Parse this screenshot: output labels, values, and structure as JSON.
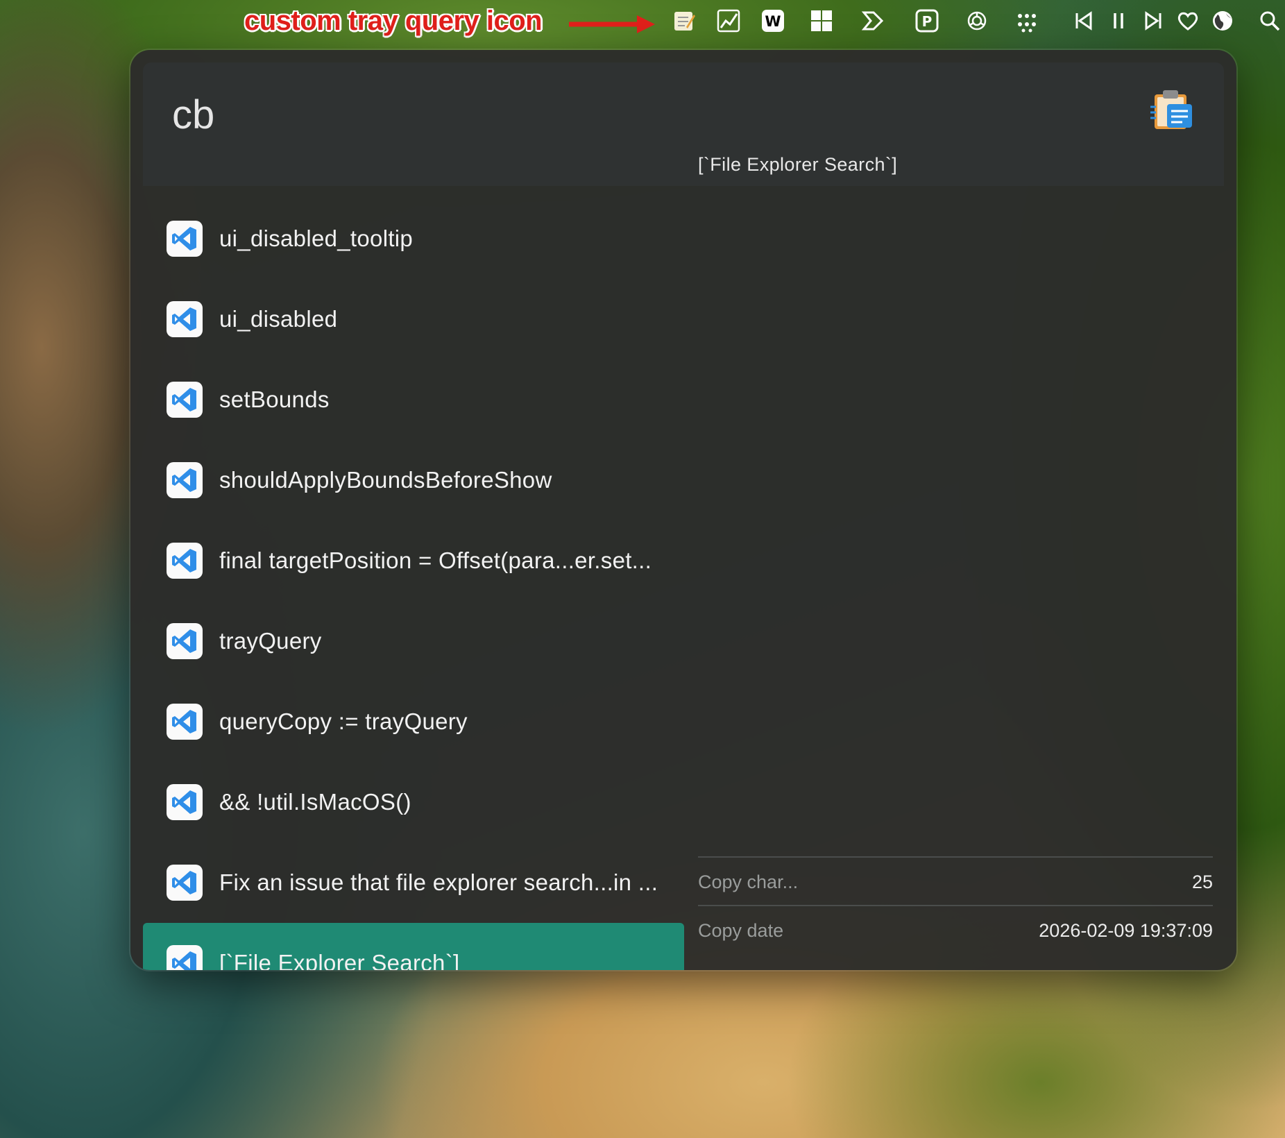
{
  "annotation": {
    "text": "custom tray query icon"
  },
  "menubar": {
    "icons": [
      "notepad-icon",
      "chart-icon",
      "word-icon",
      "grid-icon",
      "forward-arrow-icon",
      "p-app-icon",
      "openai-icon",
      "dots-icon",
      "previous-track-icon",
      "pause-icon",
      "next-track-icon",
      "heart-icon",
      "globe-icon",
      "search-icon"
    ]
  },
  "search": {
    "query": "cb",
    "plugin_icon": "clipboard-icon"
  },
  "results": [
    {
      "label": "ui_disabled_tooltip",
      "icon": "vscode-icon"
    },
    {
      "label": "ui_disabled",
      "icon": "vscode-icon"
    },
    {
      "label": "setBounds",
      "icon": "vscode-icon"
    },
    {
      "label": "shouldApplyBoundsBeforeShow",
      "icon": "vscode-icon"
    },
    {
      "label": "final targetPosition = Offset(para...er.set...",
      "icon": "vscode-icon"
    },
    {
      "label": "trayQuery",
      "icon": "vscode-icon"
    },
    {
      "label": "queryCopy := trayQuery",
      "icon": "vscode-icon"
    },
    {
      "label": "&& !util.IsMacOS()",
      "icon": "vscode-icon"
    },
    {
      "label": "Fix an issue that file explorer search...in ...",
      "icon": "vscode-icon"
    },
    {
      "label": "[`File Explorer Search`]",
      "icon": "vscode-icon",
      "selected": true
    }
  ],
  "preview": {
    "text": "[`File Explorer Search`]",
    "metadata": [
      {
        "key": "Copy char...",
        "value": "25"
      },
      {
        "key": "Copy date",
        "value": "2026-02-09 19:37:09"
      }
    ]
  },
  "colors": {
    "selection": "#1f8a74",
    "annotation": "#e1201b",
    "vscode_blue": "#2f8ee8"
  }
}
